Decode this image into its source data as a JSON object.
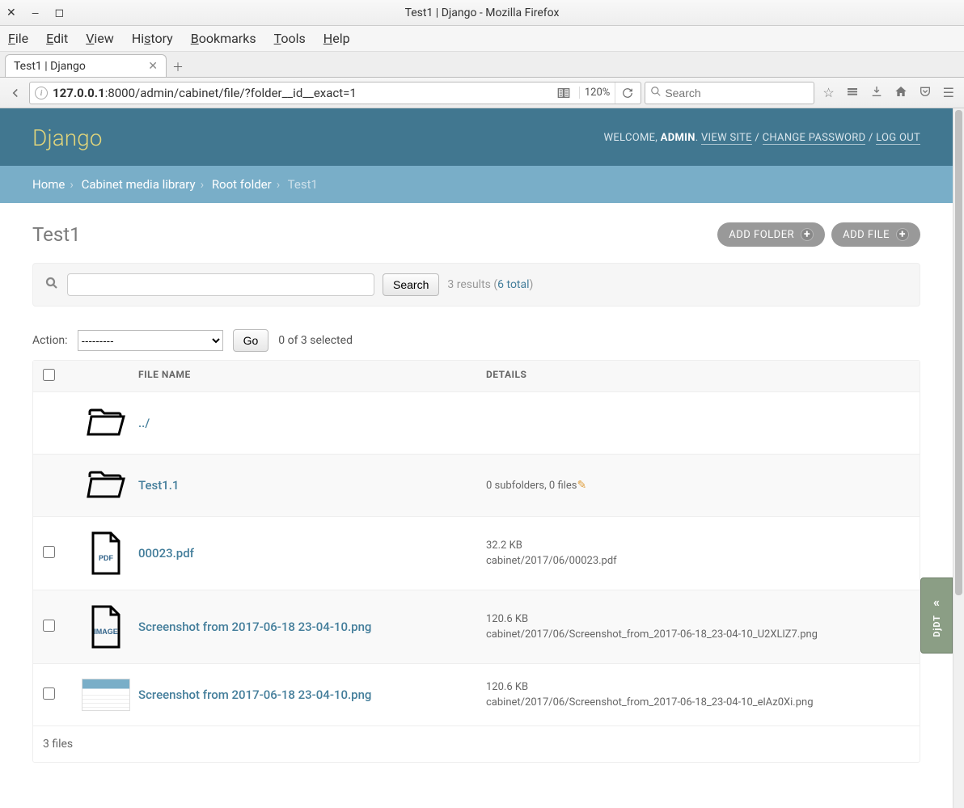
{
  "window": {
    "title": "Test1 | Django - Mozilla Firefox"
  },
  "menubar": [
    "File",
    "Edit",
    "View",
    "History",
    "Bookmarks",
    "Tools",
    "Help"
  ],
  "tab": {
    "label": "Test1 | Django"
  },
  "toolbar": {
    "url_host": "127.0.0.1",
    "url_path": ":8000/admin/cabinet/file/?folder__id__exact=1",
    "zoom": "120%",
    "search_placeholder": "Search"
  },
  "header": {
    "brand": "Django",
    "welcome": "WELCOME, ",
    "user": "ADMIN",
    "view_site": "VIEW SITE",
    "change_password": "CHANGE PASSWORD",
    "logout": "LOG OUT"
  },
  "breadcrumbs": {
    "home": "Home",
    "lib": "Cabinet media library",
    "root": "Root folder",
    "current": "Test1"
  },
  "page": {
    "title": "Test1",
    "add_folder": "ADD FOLDER",
    "add_file": "ADD FILE",
    "search_button": "Search",
    "results_prefix": "3 results (",
    "results_link": "6 total",
    "results_suffix": ")",
    "action_label": "Action:",
    "action_placeholder": "---------",
    "go": "Go",
    "selection": "0 of 3 selected",
    "th_file": "FILE NAME",
    "th_details": "DETAILS",
    "footer": "3 files"
  },
  "rows": {
    "r0": {
      "name": "../"
    },
    "r1": {
      "name": "Test1.1",
      "details": "0 subfolders, 0 files"
    },
    "r2": {
      "name": "00023.pdf",
      "size": "32.2 KB",
      "path": "cabinet/2017/06/00023.pdf"
    },
    "r3": {
      "name": "Screenshot from 2017-06-18 23-04-10.png",
      "size": "120.6 KB",
      "path": "cabinet/2017/06/Screenshot_from_2017-06-18_23-04-10_U2XLlZ7.png"
    },
    "r4": {
      "name": "Screenshot from 2017-06-18 23-04-10.png",
      "size": "120.6 KB",
      "path": "cabinet/2017/06/Screenshot_from_2017-06-18_23-04-10_elAz0Xi.png"
    }
  },
  "debug": {
    "label": "DjDT"
  }
}
